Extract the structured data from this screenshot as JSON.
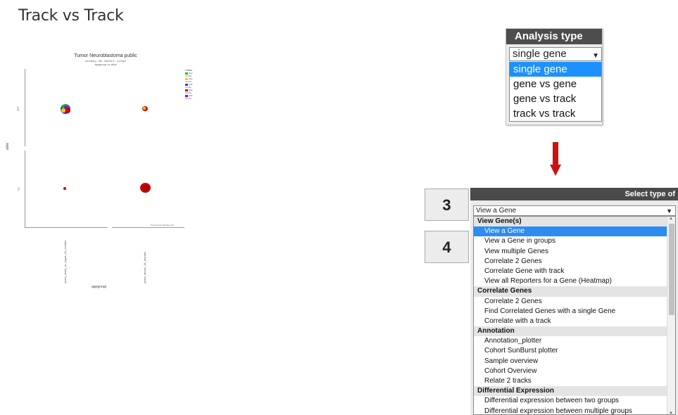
{
  "page_title": "Track vs Track",
  "plot": {
    "title": "Tumor Neuroblastoma public",
    "subtitle_1": "Versteeg - 88 - MAS5.0 - u133p2",
    "subtitle_2": "agegroup vs alive",
    "ylabel": "alive",
    "xlabel": "agegroup",
    "y_ticks": [
      "yes",
      "no"
    ],
    "x_ticks": [
      "years_lower_or_equal_18_months",
      "years_above_18_months"
    ],
    "legend_title": "Class",
    "legend_items": [
      {
        "label": "cls1 (n=18)",
        "color": "#00cc00"
      },
      {
        "label": "cls2 (n=17)",
        "color": "#ffcc00"
      },
      {
        "label": "cls3 (n=11)",
        "color": "#3333ff"
      },
      {
        "label": "cls4 (n=20)",
        "color": "#cc0000"
      },
      {
        "label": "cls5 (n=22)",
        "color": "#9900cc"
      }
    ],
    "footnote": "Powered by R2 (Sep 13)"
  },
  "analysis_type": {
    "header": "Analysis type",
    "selected": "single gene",
    "options": [
      "single gene",
      "gene vs gene",
      "gene vs track",
      "track vs track"
    ],
    "highlighted_index": 0
  },
  "steps": [
    "3",
    "4"
  ],
  "select_type": {
    "header": "Select type of",
    "selected": "View a Gene",
    "list": [
      {
        "kind": "group",
        "label": "View Gene(s)"
      },
      {
        "kind": "option",
        "label": "View a Gene",
        "selected": true
      },
      {
        "kind": "option",
        "label": "View a Gene in groups"
      },
      {
        "kind": "option",
        "label": "View multiple Genes"
      },
      {
        "kind": "option",
        "label": "Correlate 2 Genes"
      },
      {
        "kind": "option",
        "label": "Correlate Gene with track"
      },
      {
        "kind": "option",
        "label": "View all Reporters for a Gene (Heatmap)"
      },
      {
        "kind": "group",
        "label": "Correlate Genes"
      },
      {
        "kind": "option",
        "label": "Correlate 2 Genes"
      },
      {
        "kind": "option",
        "label": "Find Correlated Genes with a single Gene"
      },
      {
        "kind": "option",
        "label": "Correlate with a track"
      },
      {
        "kind": "group",
        "label": "Annotation"
      },
      {
        "kind": "option",
        "label": "Annotation_plotter"
      },
      {
        "kind": "option",
        "label": "Cohort SunBurst plotter"
      },
      {
        "kind": "option",
        "label": "Sample overview"
      },
      {
        "kind": "option",
        "label": "Cohort Overview"
      },
      {
        "kind": "option",
        "label": "Relate 2 tracks"
      },
      {
        "kind": "group",
        "label": "Differential Expression"
      },
      {
        "kind": "option",
        "label": "Differential expression between two groups"
      },
      {
        "kind": "option",
        "label": "Differential expression between multiple groups"
      }
    ]
  },
  "colors": {
    "header_bg": "#4d4d4d",
    "highlight": "#1e90ff",
    "arrow": "#cc1111"
  }
}
